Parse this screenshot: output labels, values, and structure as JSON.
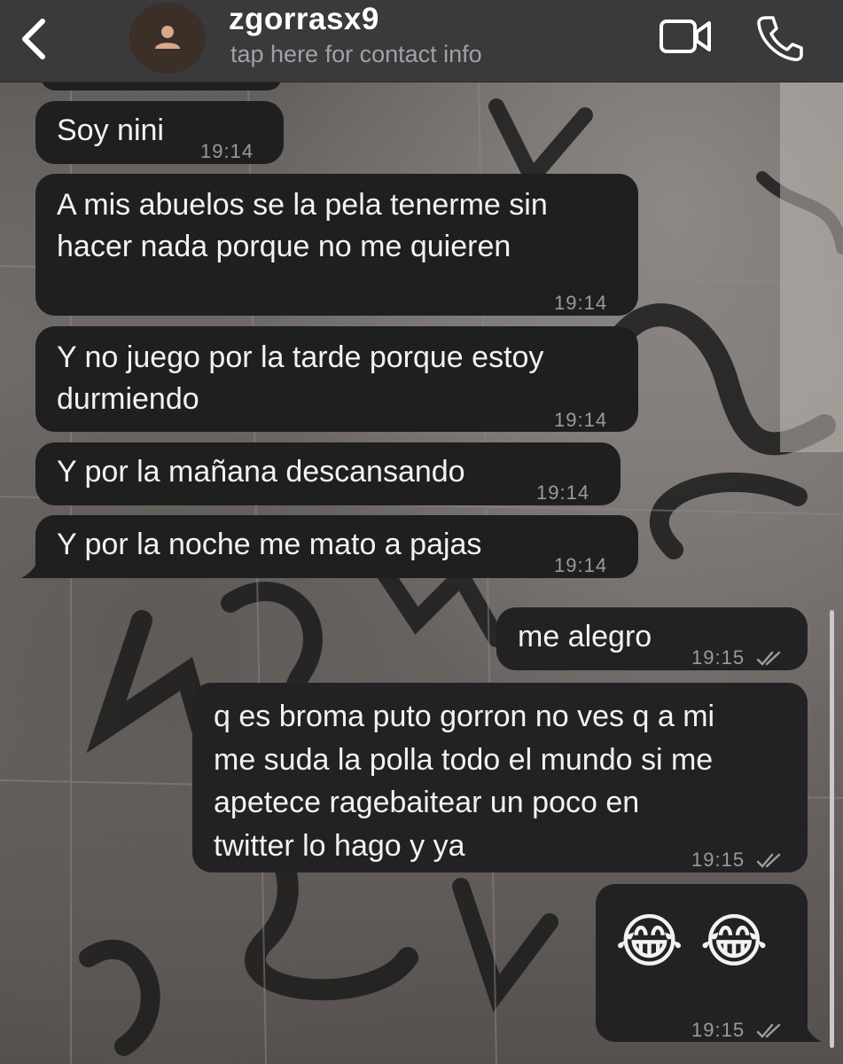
{
  "header": {
    "contact_name": "zgorrasx9",
    "subtitle": "tap here for contact info"
  },
  "messages": [
    {
      "direction": "in",
      "text": "Soy nini",
      "time": "19:14"
    },
    {
      "direction": "in",
      "text": "A mis abuelos se la pela tenerme sin\nhacer nada porque no me quieren",
      "time": "19:14"
    },
    {
      "direction": "in",
      "text": "Y no juego por la tarde porque estoy\ndurmiendo",
      "time": "19:14"
    },
    {
      "direction": "in",
      "text": "Y por la mañana descansando",
      "time": "19:14"
    },
    {
      "direction": "in",
      "text": "Y por la noche me mato a pajas",
      "time": "19:14"
    },
    {
      "direction": "out",
      "text": "me alegro",
      "time": "19:15",
      "status": "read"
    },
    {
      "direction": "out",
      "text": "q es broma puto gorron no ves q a mi\nme suda la polla todo el mundo si me\napetece ragebaitear un poco en\ntwitter lo hago y ya",
      "time": "19:15",
      "status": "read"
    },
    {
      "direction": "out",
      "text": "😂 😂",
      "time": "19:15",
      "status": "read"
    }
  ],
  "colors": {
    "header_bg": "#3a3a3c",
    "bubble_bg": "#1f1f1f",
    "text": "#f2f2f2",
    "time_text": "#9b9b9b"
  },
  "icons": [
    "back-chevron-icon",
    "person-icon",
    "video-camera-icon",
    "phone-icon",
    "double-check-icon"
  ]
}
